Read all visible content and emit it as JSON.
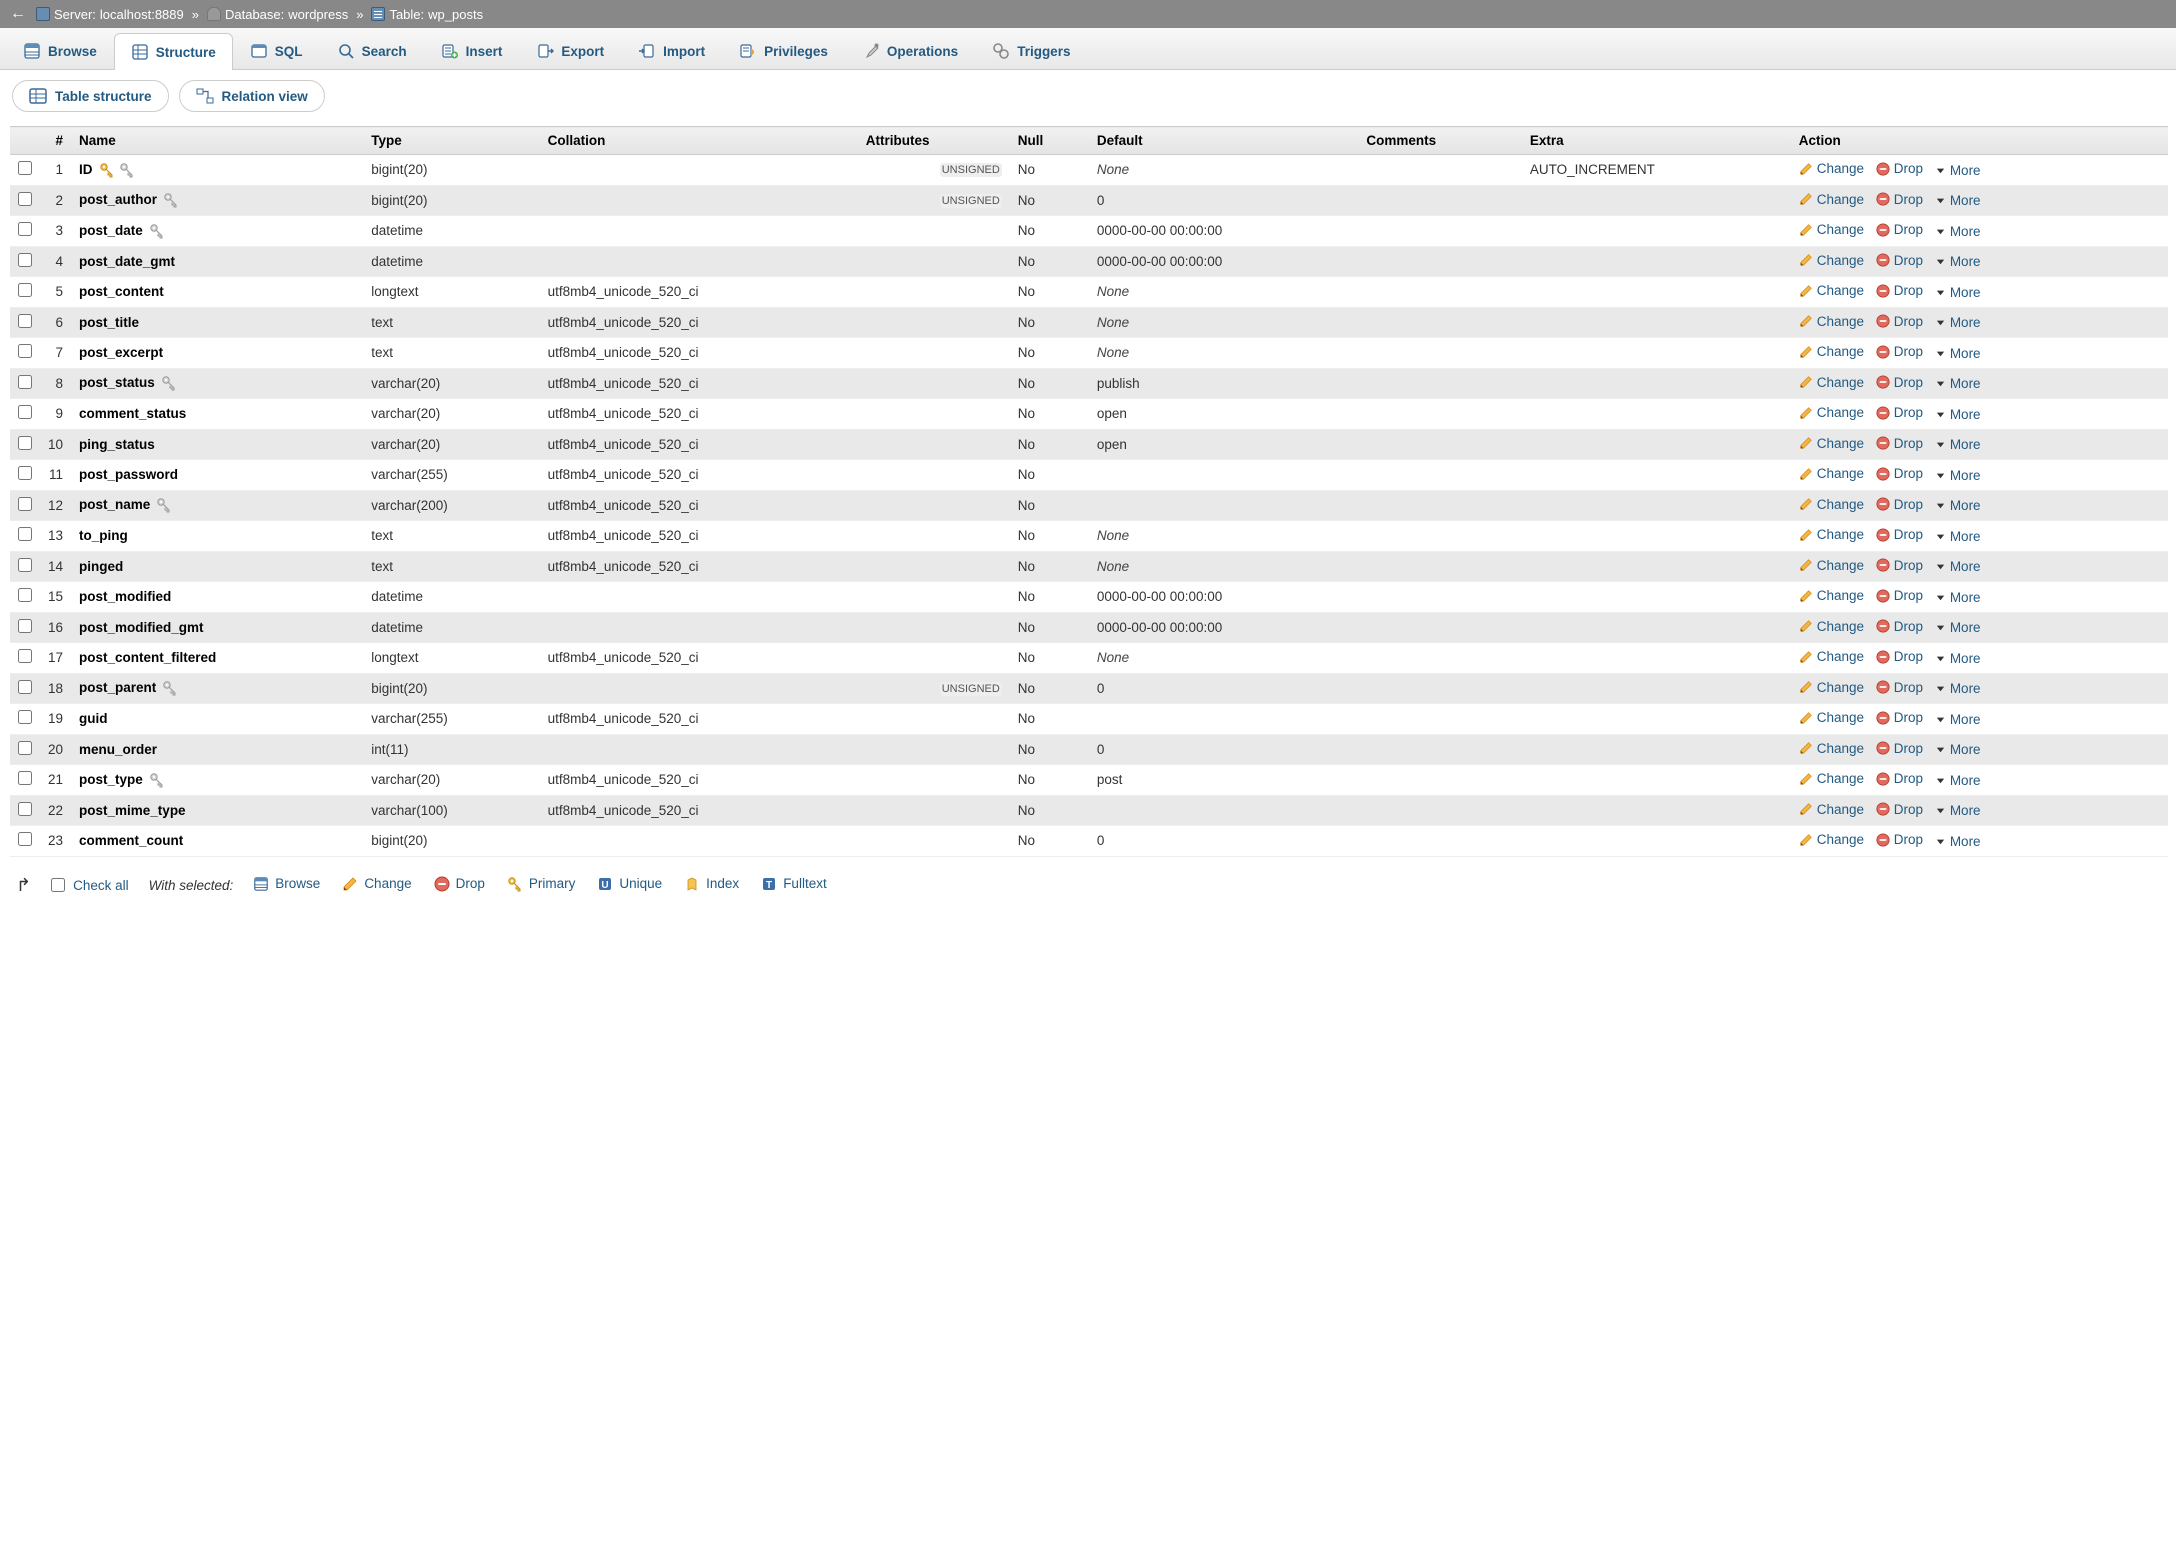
{
  "breadcrumb": {
    "server_label": "Server:",
    "server_value": "localhost:8889",
    "db_label": "Database:",
    "db_value": "wordpress",
    "table_label": "Table:",
    "table_value": "wp_posts"
  },
  "tabs": [
    {
      "id": "browse",
      "label": "Browse",
      "icon": "browse"
    },
    {
      "id": "structure",
      "label": "Structure",
      "icon": "structure",
      "active": true
    },
    {
      "id": "sql",
      "label": "SQL",
      "icon": "sql"
    },
    {
      "id": "search",
      "label": "Search",
      "icon": "search"
    },
    {
      "id": "insert",
      "label": "Insert",
      "icon": "insert"
    },
    {
      "id": "export",
      "label": "Export",
      "icon": "export"
    },
    {
      "id": "import",
      "label": "Import",
      "icon": "import"
    },
    {
      "id": "privileges",
      "label": "Privileges",
      "icon": "privileges"
    },
    {
      "id": "operations",
      "label": "Operations",
      "icon": "operations"
    },
    {
      "id": "triggers",
      "label": "Triggers",
      "icon": "triggers"
    }
  ],
  "subtabs": {
    "table_structure": "Table structure",
    "relation_view": "Relation view"
  },
  "headers": {
    "num": "#",
    "name": "Name",
    "type": "Type",
    "collation": "Collation",
    "attributes": "Attributes",
    "null": "Null",
    "default": "Default",
    "comments": "Comments",
    "extra": "Extra",
    "action": "Action"
  },
  "action_labels": {
    "change": "Change",
    "drop": "Drop",
    "more": "More"
  },
  "columns": [
    {
      "n": 1,
      "name": "ID",
      "key": "primary",
      "idx": true,
      "type": "bigint(20)",
      "collation": "",
      "attr": "UNSIGNED",
      "null": "No",
      "default": "None",
      "def_none": true,
      "extra": "AUTO_INCREMENT"
    },
    {
      "n": 2,
      "name": "post_author",
      "key": "",
      "idx": true,
      "type": "bigint(20)",
      "collation": "",
      "attr": "UNSIGNED",
      "null": "No",
      "default": "0",
      "def_none": false,
      "extra": ""
    },
    {
      "n": 3,
      "name": "post_date",
      "key": "",
      "idx": true,
      "type": "datetime",
      "collation": "",
      "attr": "",
      "null": "No",
      "default": "0000-00-00 00:00:00",
      "def_none": false,
      "extra": ""
    },
    {
      "n": 4,
      "name": "post_date_gmt",
      "key": "",
      "idx": false,
      "type": "datetime",
      "collation": "",
      "attr": "",
      "null": "No",
      "default": "0000-00-00 00:00:00",
      "def_none": false,
      "extra": ""
    },
    {
      "n": 5,
      "name": "post_content",
      "key": "",
      "idx": false,
      "type": "longtext",
      "collation": "utf8mb4_unicode_520_ci",
      "attr": "",
      "null": "No",
      "default": "None",
      "def_none": true,
      "extra": ""
    },
    {
      "n": 6,
      "name": "post_title",
      "key": "",
      "idx": false,
      "type": "text",
      "collation": "utf8mb4_unicode_520_ci",
      "attr": "",
      "null": "No",
      "default": "None",
      "def_none": true,
      "extra": ""
    },
    {
      "n": 7,
      "name": "post_excerpt",
      "key": "",
      "idx": false,
      "type": "text",
      "collation": "utf8mb4_unicode_520_ci",
      "attr": "",
      "null": "No",
      "default": "None",
      "def_none": true,
      "extra": ""
    },
    {
      "n": 8,
      "name": "post_status",
      "key": "",
      "idx": true,
      "type": "varchar(20)",
      "collation": "utf8mb4_unicode_520_ci",
      "attr": "",
      "null": "No",
      "default": "publish",
      "def_none": false,
      "extra": ""
    },
    {
      "n": 9,
      "name": "comment_status",
      "key": "",
      "idx": false,
      "type": "varchar(20)",
      "collation": "utf8mb4_unicode_520_ci",
      "attr": "",
      "null": "No",
      "default": "open",
      "def_none": false,
      "extra": ""
    },
    {
      "n": 10,
      "name": "ping_status",
      "key": "",
      "idx": false,
      "type": "varchar(20)",
      "collation": "utf8mb4_unicode_520_ci",
      "attr": "",
      "null": "No",
      "default": "open",
      "def_none": false,
      "extra": ""
    },
    {
      "n": 11,
      "name": "post_password",
      "key": "",
      "idx": false,
      "type": "varchar(255)",
      "collation": "utf8mb4_unicode_520_ci",
      "attr": "",
      "null": "No",
      "default": "",
      "def_none": false,
      "def_empty": true,
      "extra": ""
    },
    {
      "n": 12,
      "name": "post_name",
      "key": "",
      "idx": true,
      "type": "varchar(200)",
      "collation": "utf8mb4_unicode_520_ci",
      "attr": "",
      "null": "No",
      "default": "",
      "def_none": false,
      "def_empty": true,
      "extra": ""
    },
    {
      "n": 13,
      "name": "to_ping",
      "key": "",
      "idx": false,
      "type": "text",
      "collation": "utf8mb4_unicode_520_ci",
      "attr": "",
      "null": "No",
      "default": "None",
      "def_none": true,
      "extra": ""
    },
    {
      "n": 14,
      "name": "pinged",
      "key": "",
      "idx": false,
      "type": "text",
      "collation": "utf8mb4_unicode_520_ci",
      "attr": "",
      "null": "No",
      "default": "None",
      "def_none": true,
      "extra": ""
    },
    {
      "n": 15,
      "name": "post_modified",
      "key": "",
      "idx": false,
      "type": "datetime",
      "collation": "",
      "attr": "",
      "null": "No",
      "default": "0000-00-00 00:00:00",
      "def_none": false,
      "extra": ""
    },
    {
      "n": 16,
      "name": "post_modified_gmt",
      "key": "",
      "idx": false,
      "type": "datetime",
      "collation": "",
      "attr": "",
      "null": "No",
      "default": "0000-00-00 00:00:00",
      "def_none": false,
      "extra": ""
    },
    {
      "n": 17,
      "name": "post_content_filtered",
      "key": "",
      "idx": false,
      "type": "longtext",
      "collation": "utf8mb4_unicode_520_ci",
      "attr": "",
      "null": "No",
      "default": "None",
      "def_none": true,
      "extra": ""
    },
    {
      "n": 18,
      "name": "post_parent",
      "key": "",
      "idx": true,
      "type": "bigint(20)",
      "collation": "",
      "attr": "UNSIGNED",
      "null": "No",
      "default": "0",
      "def_none": false,
      "extra": ""
    },
    {
      "n": 19,
      "name": "guid",
      "key": "",
      "idx": false,
      "type": "varchar(255)",
      "collation": "utf8mb4_unicode_520_ci",
      "attr": "",
      "null": "No",
      "default": "",
      "def_none": false,
      "def_empty": true,
      "extra": ""
    },
    {
      "n": 20,
      "name": "menu_order",
      "key": "",
      "idx": false,
      "type": "int(11)",
      "collation": "",
      "attr": "",
      "null": "No",
      "default": "0",
      "def_none": false,
      "extra": ""
    },
    {
      "n": 21,
      "name": "post_type",
      "key": "",
      "idx": true,
      "type": "varchar(20)",
      "collation": "utf8mb4_unicode_520_ci",
      "attr": "",
      "null": "No",
      "default": "post",
      "def_none": false,
      "extra": ""
    },
    {
      "n": 22,
      "name": "post_mime_type",
      "key": "",
      "idx": false,
      "type": "varchar(100)",
      "collation": "utf8mb4_unicode_520_ci",
      "attr": "",
      "null": "No",
      "default": "",
      "def_none": false,
      "def_empty": true,
      "extra": ""
    },
    {
      "n": 23,
      "name": "comment_count",
      "key": "",
      "idx": false,
      "type": "bigint(20)",
      "collation": "",
      "attr": "",
      "null": "No",
      "default": "0",
      "def_none": false,
      "extra": ""
    }
  ],
  "footer": {
    "check_all": "Check all",
    "with_selected": "With selected:",
    "buttons": [
      {
        "id": "browse",
        "label": "Browse",
        "icon": "browse"
      },
      {
        "id": "change",
        "label": "Change",
        "icon": "pencil"
      },
      {
        "id": "drop",
        "label": "Drop",
        "icon": "drop"
      },
      {
        "id": "primary",
        "label": "Primary",
        "icon": "key-gold"
      },
      {
        "id": "unique",
        "label": "Unique",
        "icon": "unique"
      },
      {
        "id": "index",
        "label": "Index",
        "icon": "index"
      },
      {
        "id": "fulltext",
        "label": "Fulltext",
        "icon": "fulltext"
      }
    ]
  }
}
